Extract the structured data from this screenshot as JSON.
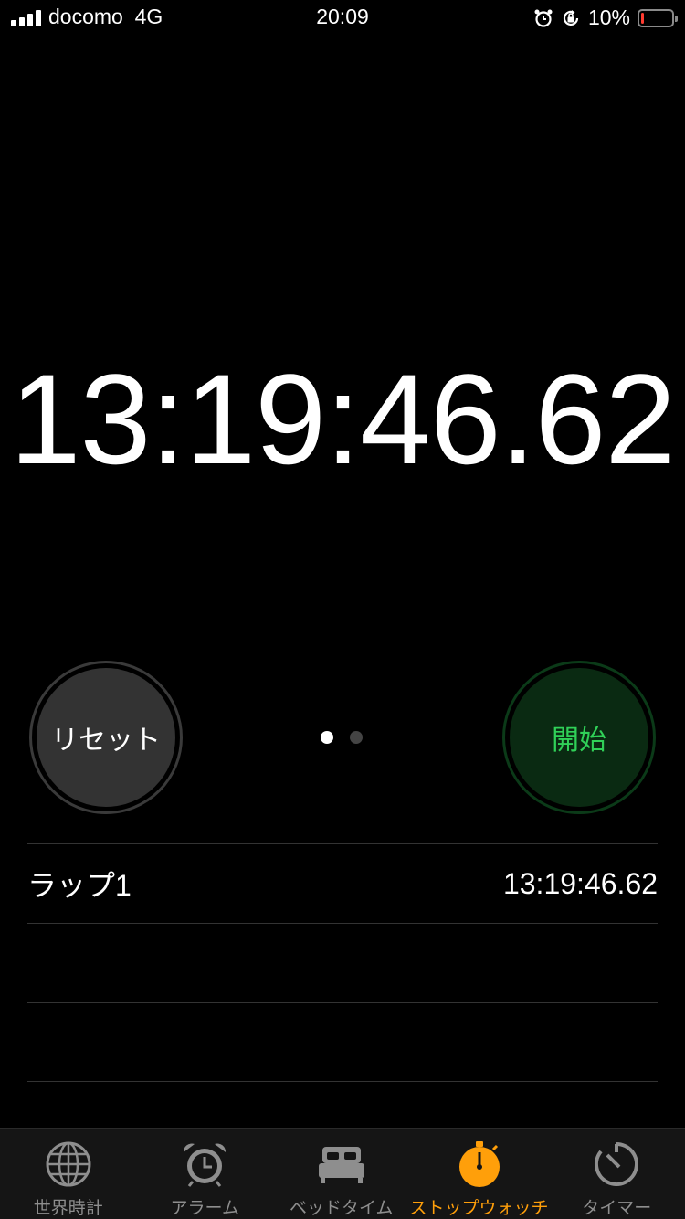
{
  "status_bar": {
    "carrier": "docomo",
    "network": "4G",
    "time": "20:09",
    "battery_percent": "10%",
    "battery_level": 0.1,
    "icons": [
      "alarm-icon",
      "orientation-lock-icon"
    ]
  },
  "stopwatch": {
    "time": "13:19:46.62",
    "reset_label": "リセット",
    "start_label": "開始",
    "page_count": 2,
    "active_page": 0
  },
  "laps": [
    {
      "label": "ラップ1",
      "time": "13:19:46.62"
    },
    {
      "label": "",
      "time": ""
    },
    {
      "label": "",
      "time": ""
    }
  ],
  "tab_bar": {
    "items": [
      {
        "label": "世界時計",
        "icon": "globe-icon"
      },
      {
        "label": "アラーム",
        "icon": "alarm-clock-icon"
      },
      {
        "label": "ベッドタイム",
        "icon": "bed-icon"
      },
      {
        "label": "ストップウォッチ",
        "icon": "stopwatch-icon",
        "active": true
      },
      {
        "label": "タイマー",
        "icon": "timer-icon"
      }
    ]
  },
  "colors": {
    "accent": "#ff9f0a",
    "start_green": "#30d158",
    "battery_low": "#ff3b30"
  }
}
